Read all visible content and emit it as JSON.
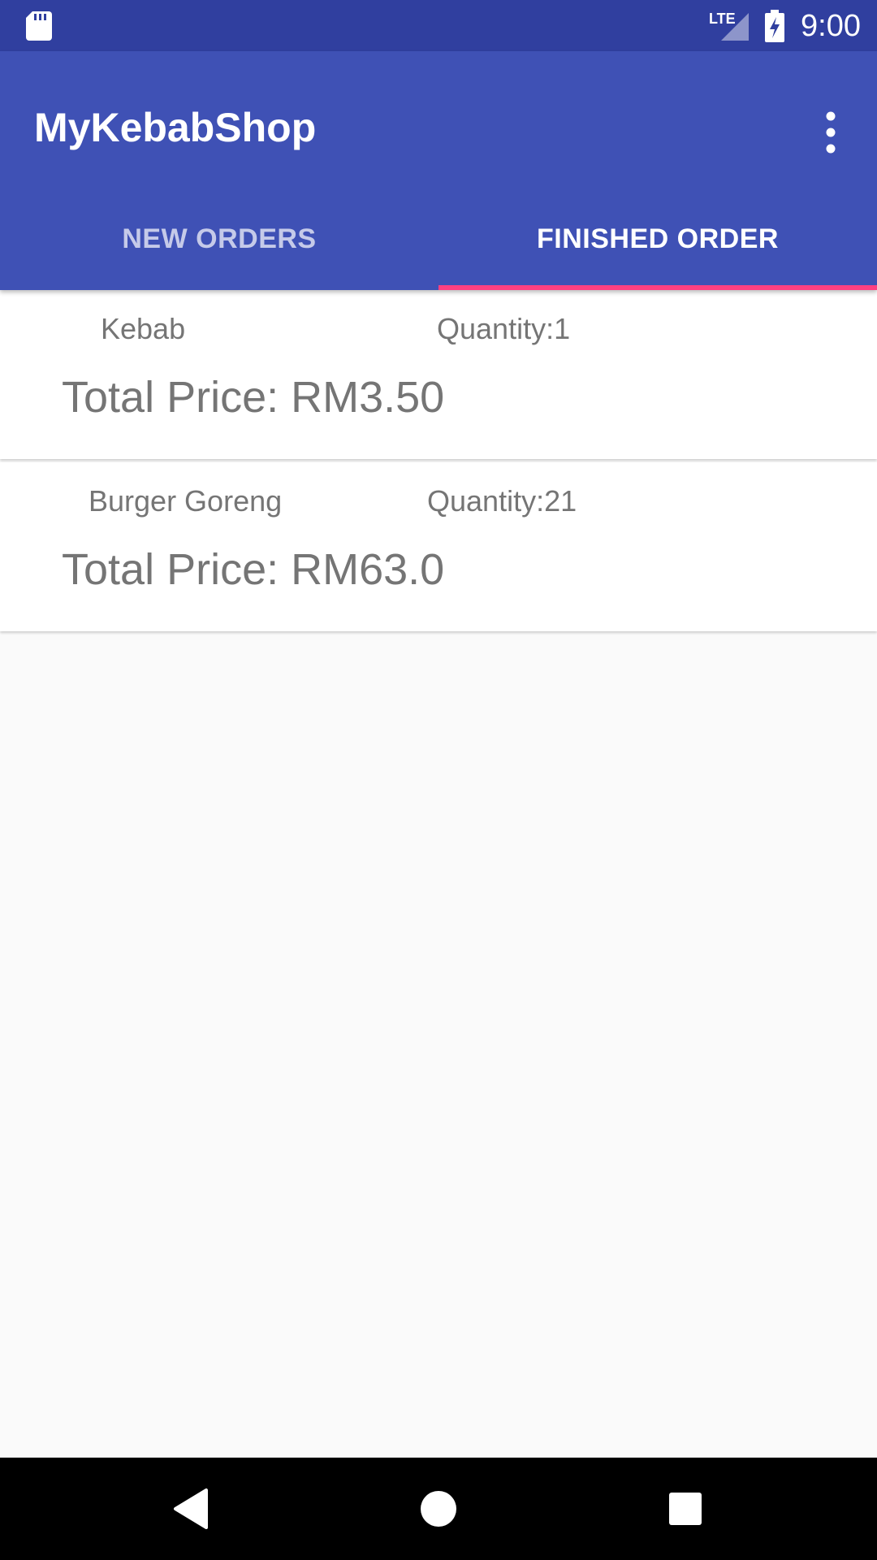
{
  "status_bar": {
    "time": "9:00",
    "network_label": "LTE",
    "icons": [
      "sd-card-icon",
      "lte-signal-icon",
      "battery-charging-icon"
    ]
  },
  "app_bar": {
    "title": "MyKebabShop",
    "menu_icon": "more-vert-icon"
  },
  "tabs": [
    {
      "label": "NEW ORDERS",
      "selected": false
    },
    {
      "label": "FINISHED ORDER",
      "selected": true
    }
  ],
  "orders": [
    {
      "name": "Kebab",
      "quantity": "Quantity:1",
      "total": "Total Price: RM3.50"
    },
    {
      "name": "Burger Goreng",
      "quantity": "Quantity:21",
      "total": "Total Price: RM63.0"
    }
  ],
  "nav_bar": {
    "icons": [
      "back-icon",
      "home-icon",
      "recents-icon"
    ]
  },
  "colors": {
    "primary": "#3f51b5",
    "primary_dark": "#303f9f",
    "accent": "#ff4081",
    "text_secondary": "#757575",
    "background": "#fafafa"
  }
}
